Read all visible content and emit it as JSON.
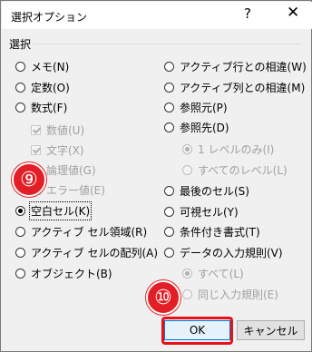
{
  "window": {
    "title": "選択オプション",
    "help": "?",
    "close": "✕"
  },
  "group_label": "選択",
  "left_options": [
    {
      "label": "メモ(N)"
    },
    {
      "label": "定数(O)"
    },
    {
      "label": "数式(F)"
    },
    {
      "label": "数値(U)"
    },
    {
      "label": "文字(X)"
    },
    {
      "label": "論理値(G)"
    },
    {
      "label": "エラー値(E)"
    },
    {
      "label": "空白セル(K)"
    },
    {
      "label": "アクティブ セル領域(R)"
    },
    {
      "label": "アクティブ セルの配列(A)"
    },
    {
      "label": "オブジェクト(B)"
    }
  ],
  "right_options": [
    {
      "label": "アクティブ行との相違(W)"
    },
    {
      "label": "アクティブ列との相違(M)"
    },
    {
      "label": "参照元(P)"
    },
    {
      "label": "参照先(D)"
    },
    {
      "label": "1 レベルのみ(I)"
    },
    {
      "label": "すべてのレベル(L)"
    },
    {
      "label": "最後のセル(S)"
    },
    {
      "label": "可視セル(Y)"
    },
    {
      "label": "条件付き書式(T)"
    },
    {
      "label": "データの入力規則(V)"
    },
    {
      "label": "すべて(L)"
    },
    {
      "label": "同じ入力規則(E)"
    }
  ],
  "badges": {
    "nine": "⑨",
    "ten": "⑩"
  },
  "buttons": {
    "ok": "OK",
    "cancel": "キャンセル"
  },
  "colors": {
    "badge": "#e21f26",
    "highlight": "#e8101a",
    "ok_border": "#0078d7"
  }
}
